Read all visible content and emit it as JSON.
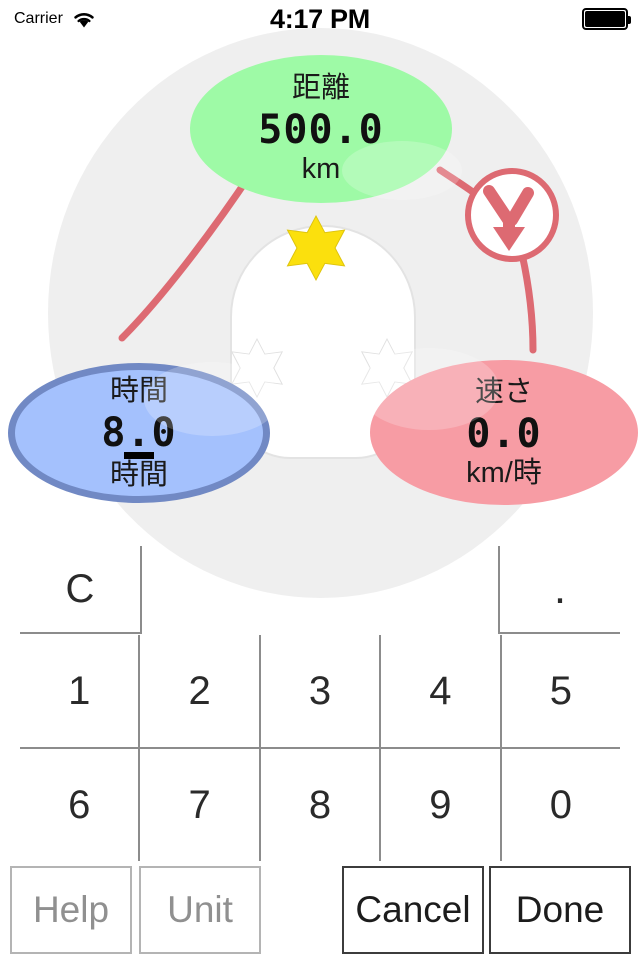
{
  "status_bar": {
    "carrier": "Carrier",
    "wifi_icon": "wifi-icon",
    "time": "4:17 PM",
    "battery_icon": "battery-icon"
  },
  "diagram": {
    "operation_icon": "merge-arrow-down-icon",
    "star_top_icon": "star-icon",
    "star_left_icon": "star-icon",
    "star_right_icon": "star-icon",
    "nodes": [
      {
        "id": "distance",
        "label": "距離",
        "value": "500.0",
        "unit": "km",
        "color": "#9efaa6",
        "selected": false
      },
      {
        "id": "time",
        "label": "時間",
        "value": "8.0",
        "unit": "時間",
        "color": "#a4c1fd",
        "border_color": "#7189c4",
        "selected": true
      },
      {
        "id": "speed",
        "label": "速さ",
        "value": "0.0",
        "unit": "km/時",
        "color": "#f79ca4",
        "selected": false
      }
    ],
    "connector_color": "#dd6a72"
  },
  "keypad": {
    "clear_label": "C",
    "decimal_label": ".",
    "row1": [
      "1",
      "2",
      "3",
      "4",
      "5"
    ],
    "row2": [
      "6",
      "7",
      "8",
      "9",
      "0"
    ]
  },
  "actions": {
    "help": "Help",
    "unit": "Unit",
    "cancel": "Cancel",
    "done": "Done"
  }
}
